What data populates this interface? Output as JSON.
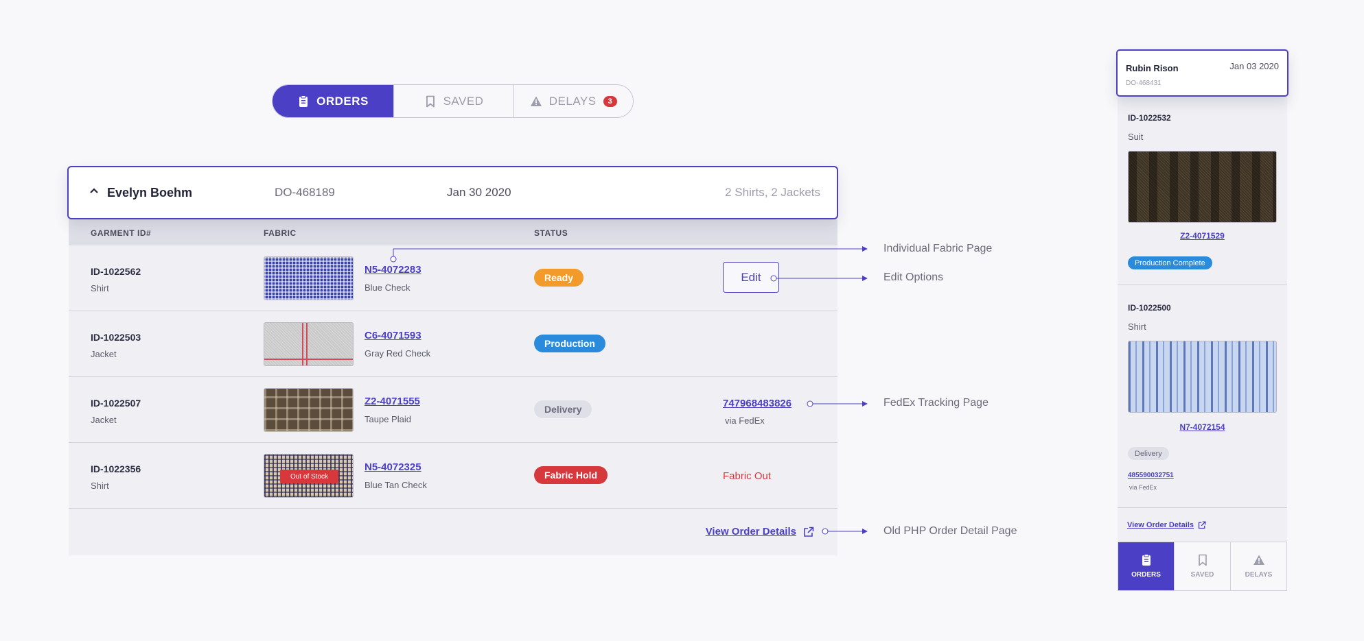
{
  "tabs": {
    "orders": "ORDERS",
    "saved": "SAVED",
    "delays": "DELAYS",
    "delays_count": "3"
  },
  "order": {
    "customer": "Evelyn Boehm",
    "number": "DO-468189",
    "date": "Jan 30 2020",
    "summary": "2 Shirts, 2 Jackets"
  },
  "table": {
    "headers": {
      "garment": "GARMENT ID#",
      "fabric": "FABRIC",
      "status": "STATUS"
    },
    "rows": [
      {
        "id": "ID-1022562",
        "type": "Shirt",
        "fabric_code": "N5-4072283",
        "fabric_name": "Blue Check",
        "status": "Ready",
        "action": "Edit"
      },
      {
        "id": "ID-1022503",
        "type": "Jacket",
        "fabric_code": "C6-4071593",
        "fabric_name": "Gray Red Check",
        "status": "Production"
      },
      {
        "id": "ID-1022507",
        "type": "Jacket",
        "fabric_code": "Z2-4071555",
        "fabric_name": "Taupe Plaid",
        "status": "Delivery",
        "tracking": "747968483826",
        "carrier": "via FedEx"
      },
      {
        "id": "ID-1022356",
        "type": "Shirt",
        "fabric_code": "N5-4072325",
        "fabric_name": "Blue Tan Check",
        "status": "Fabric Hold",
        "note": "Fabric Out",
        "swatch_label": "Out of Stock"
      }
    ],
    "view_details": "View Order Details"
  },
  "callouts": {
    "fabric_page": "Individual Fabric Page",
    "edit_options": "Edit Options",
    "fedex_page": "FedEx Tracking Page",
    "old_php": "Old PHP Order Detail Page"
  },
  "mobile": {
    "customer": "Rubin Rison",
    "date": "Jan 03 2020",
    "order_no": "DO-468431",
    "items": [
      {
        "id": "ID-1022532",
        "type": "Suit",
        "fabric_code": "Z2-4071529",
        "status": "Production Complete"
      },
      {
        "id": "ID-1022500",
        "type": "Shirt",
        "fabric_code": "N7-4072154",
        "status": "Delivery",
        "tracking": "485590032751",
        "carrier": "via FedEx"
      }
    ],
    "view_details": "View Order Details",
    "nav": {
      "orders": "ORDERS",
      "saved": "SAVED",
      "delays": "DELAYS"
    }
  },
  "colors": {
    "accent": "#4b3fc6",
    "ready": "#f29b2a",
    "production": "#2a8adb",
    "hold": "#d7383c"
  }
}
